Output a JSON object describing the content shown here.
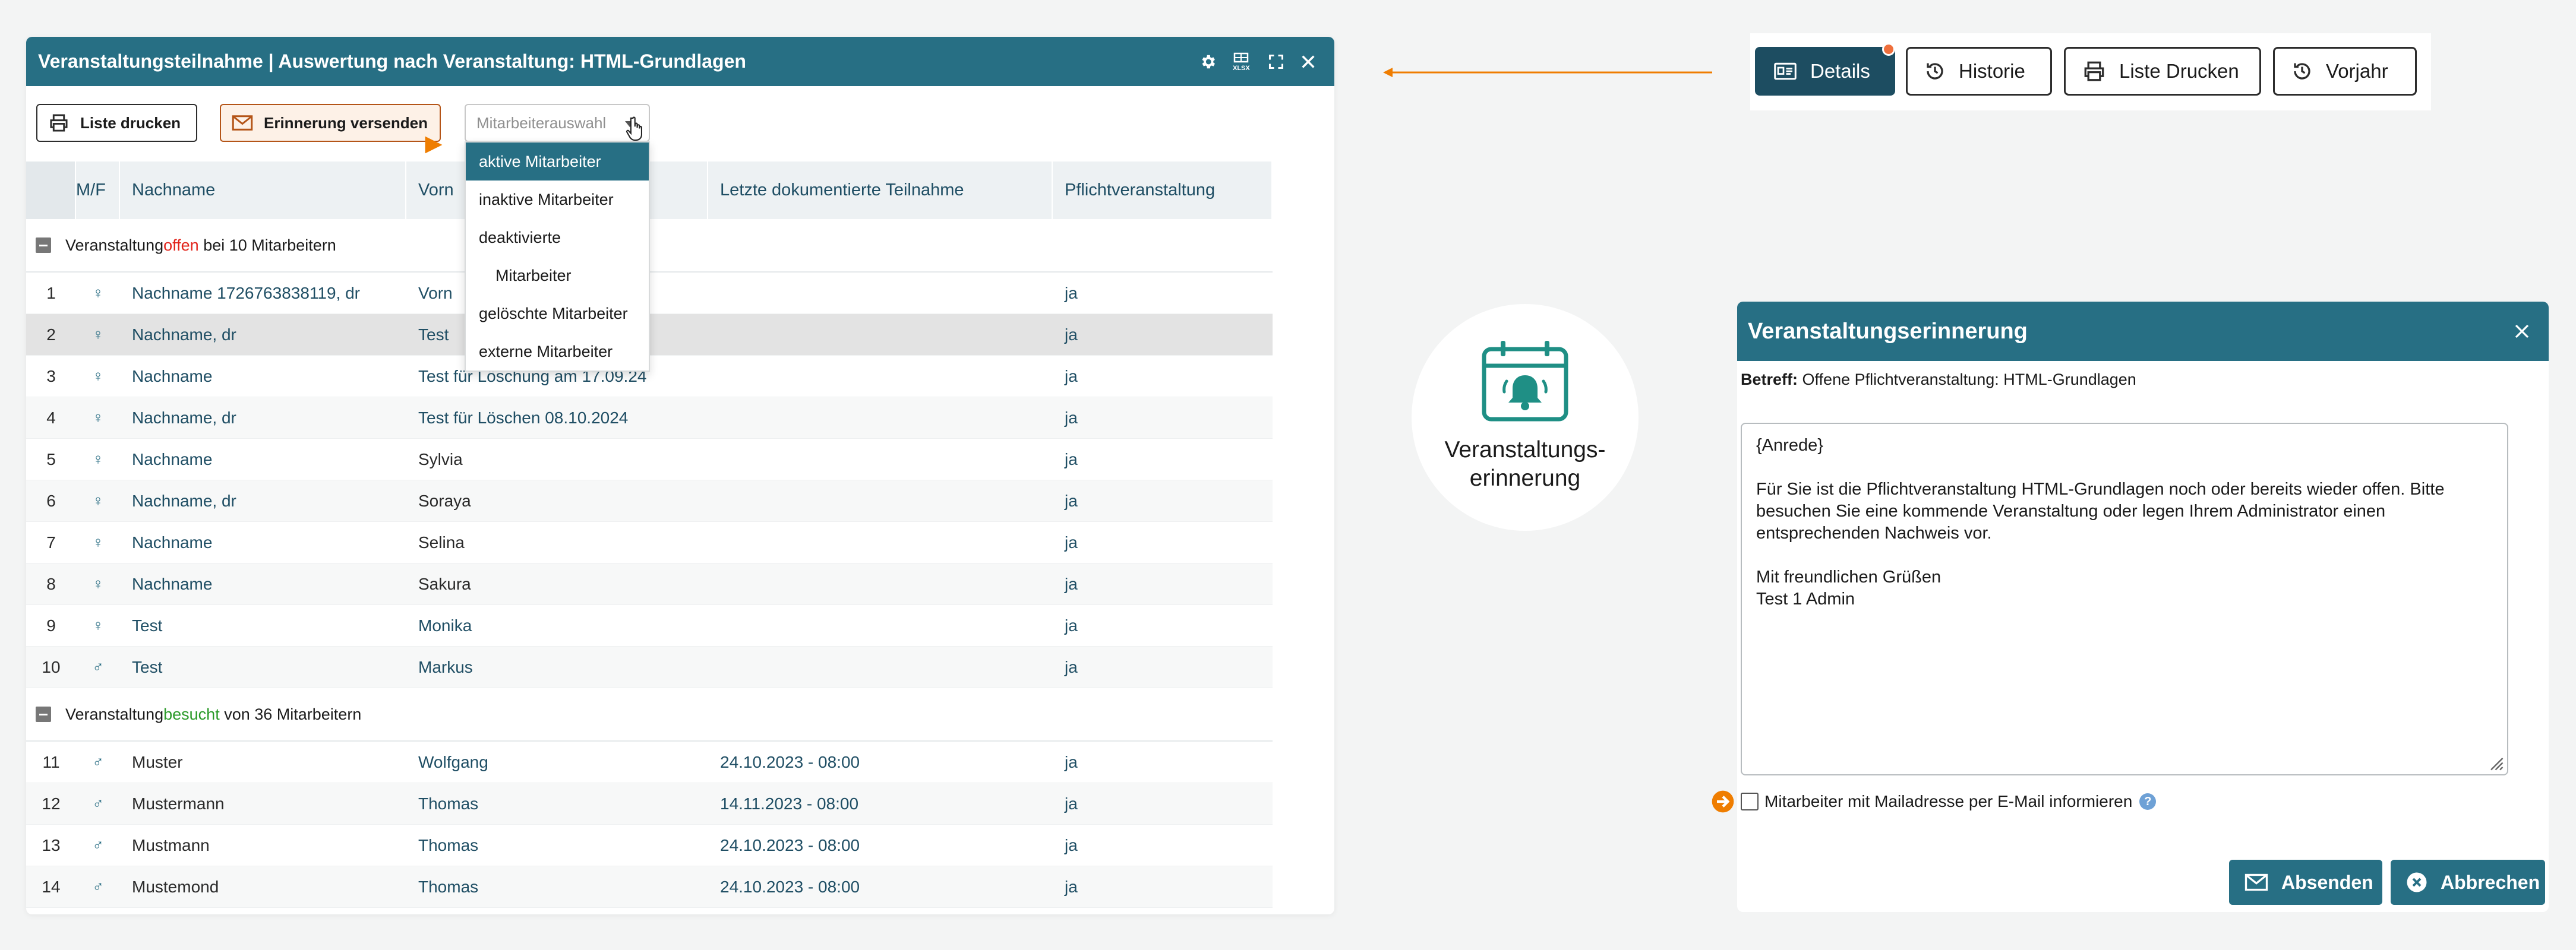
{
  "window": {
    "title": "Veranstaltungsteilnahme | Auswertung nach Veranstaltung: HTML-Grundlagen",
    "controls": [
      "gear-icon",
      "xlsx-icon",
      "expand-icon",
      "close-icon"
    ],
    "xlsx_label": "XLSX"
  },
  "toolbar": {
    "print_label": "Liste drucken",
    "remind_label": "Erinnerung versenden",
    "select_placeholder": "Mitarbeiterauswahl"
  },
  "dropdown": {
    "options": [
      "aktive Mitarbeiter",
      "inaktive Mitarbeiter",
      "deaktivierte",
      "Mitarbeiter",
      "gelöschte Mitarbeiter",
      "externe Mitarbeiter"
    ],
    "selected": "aktive Mitarbeiter"
  },
  "table": {
    "headers": [
      "",
      "M/F",
      "Nachname",
      "Vorn",
      "Letzte dokumentierte Teilnahme",
      "Pflichtveranstaltung"
    ],
    "group_open": {
      "prefix": "Veranstaltung ",
      "keyword": "offen",
      "suffix": " bei 10 Mitarbeitern"
    },
    "group_visited": {
      "prefix": "Veranstaltung ",
      "keyword": "besucht",
      "suffix": " von 36 Mitarbeitern"
    },
    "rows_open": [
      {
        "num": "1",
        "g": "♀",
        "nachname": "Nachname 1726763838119, dr",
        "vorname": "Vorn",
        "last": "",
        "pflicht": "ja"
      },
      {
        "num": "2",
        "g": "♀",
        "nachname": "Nachname, dr",
        "vorname": "Test",
        "last": "",
        "pflicht": "ja"
      },
      {
        "num": "3",
        "g": "♀",
        "nachname": "Nachname",
        "vorname": "Test für Löschung am 17.09.24",
        "last": "",
        "pflicht": "ja"
      },
      {
        "num": "4",
        "g": "♀",
        "nachname": "Nachname, dr",
        "vorname": "Test für Löschen 08.10.2024",
        "last": "",
        "pflicht": "ja"
      },
      {
        "num": "5",
        "g": "♀",
        "nachname": "Nachname",
        "vorname": "Sylvia",
        "last": "",
        "pflicht": "ja"
      },
      {
        "num": "6",
        "g": "♀",
        "nachname": "Nachname, dr",
        "vorname": "Soraya",
        "last": "",
        "pflicht": "ja"
      },
      {
        "num": "7",
        "g": "♀",
        "nachname": "Nachname",
        "vorname": "Selina",
        "last": "",
        "pflicht": "ja"
      },
      {
        "num": "8",
        "g": "♀",
        "nachname": "Nachname",
        "vorname": "Sakura",
        "last": "",
        "pflicht": "ja"
      },
      {
        "num": "9",
        "g": "♀",
        "nachname": "Test",
        "vorname": "Monika",
        "last": "",
        "pflicht": "ja"
      },
      {
        "num": "10",
        "g": "♂",
        "nachname": "Test",
        "vorname": "Markus",
        "last": "",
        "pflicht": "ja"
      }
    ],
    "rows_visited": [
      {
        "num": "11",
        "g": "♂",
        "nachname": "Muster",
        "vorname": "Wolfgang",
        "last": "24.10.2023 - 08:00",
        "pflicht": "ja"
      },
      {
        "num": "12",
        "g": "♂",
        "nachname": "Mustermann",
        "vorname": "Thomas",
        "last": "14.11.2023 - 08:00",
        "pflicht": "ja"
      },
      {
        "num": "13",
        "g": "♂",
        "nachname": "Mustmann",
        "vorname": "Thomas",
        "last": "24.10.2023 - 08:00",
        "pflicht": "ja"
      },
      {
        "num": "14",
        "g": "♂",
        "nachname": "Mustemond",
        "vorname": "Thomas",
        "last": "24.10.2023 - 08:00",
        "pflicht": "ja"
      }
    ]
  },
  "button_bar": {
    "details": "Details",
    "historie": "Historie",
    "liste_drucken": "Liste Drucken",
    "vorjahr": "Vorjahr"
  },
  "feature": {
    "label": "Veranstaltungs-\nerinnerung",
    "icon": "calendar-bell-icon"
  },
  "dialog": {
    "title": "Veranstaltungserinnerung",
    "subject_label": "Betreff:",
    "subject_value": "Offene Pflichtveranstaltung: HTML-Grundlagen",
    "message_lines": [
      "{Anrede}",
      "",
      "Für Sie ist die Pflichtveranstaltung HTML-Grundlagen noch oder bereits wieder offen. Bitte",
      "besuchen Sie eine kommende Veranstaltung oder legen Ihrem Administrator einen",
      "entsprechenden Nachweis vor.",
      "",
      "Mit freundlichen Grüßen",
      "Test 1 Admin"
    ],
    "checkbox_label": "Mitarbeiter mit Mailadresse per E-Mail informieren",
    "help_label": "?",
    "send_label": "Absenden",
    "cancel_label": "Abbrechen"
  },
  "colors": {
    "header_teal": "#276f84",
    "accent_orange": "#ef7d00",
    "open_red": "#e2231a",
    "visited_green": "#2a9a28",
    "details_dark": "#1d4d61"
  }
}
